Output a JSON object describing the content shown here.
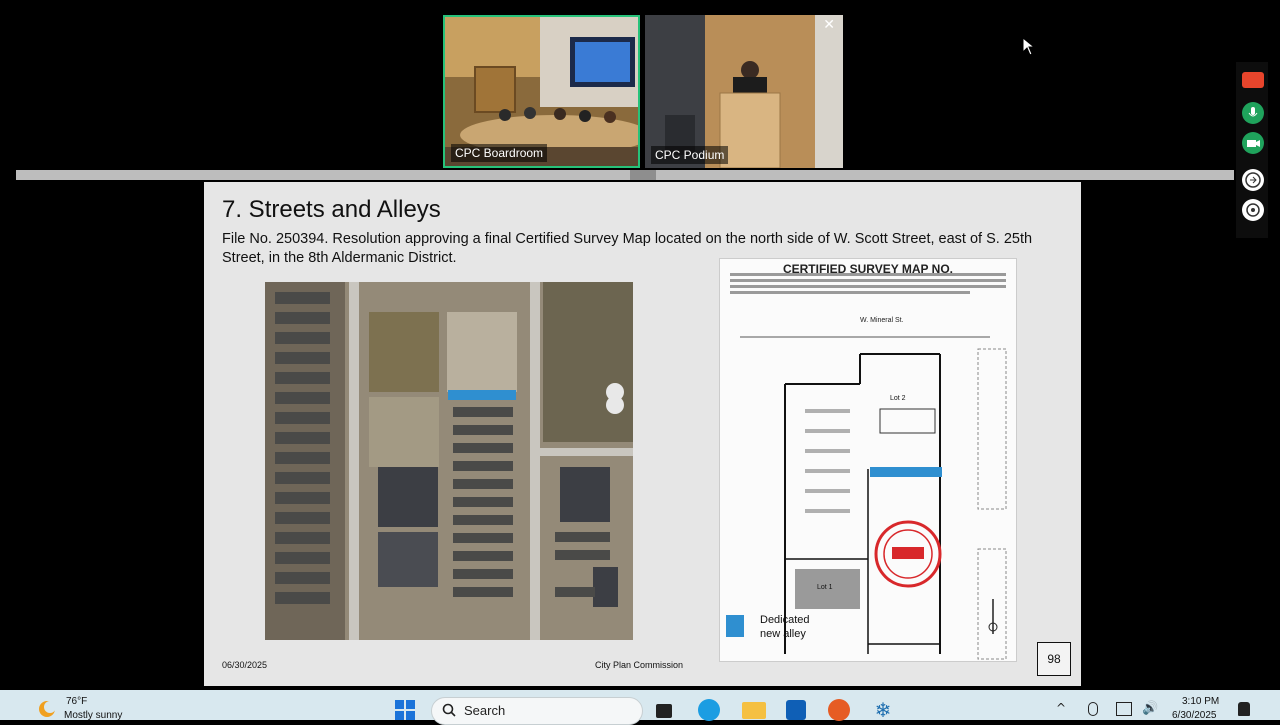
{
  "video": {
    "tiles": [
      {
        "label": "CPC Boardroom"
      },
      {
        "label": "CPC Podium"
      }
    ]
  },
  "slide": {
    "title": "7. Streets and Alleys",
    "description": "File No. 250394. Resolution approving a final Certified Survey Map located on the north side of W. Scott Street, east of S. 25th Street, in the 8th Aldermanic District.",
    "csm_title": "CERTIFIED SURVEY MAP NO.",
    "csm_street_top": "W. Mineral St.",
    "csm_lot2": "Lot 2",
    "csm_lot1": "Lot 1",
    "legend_label": "Dedicated new alley",
    "date": "06/30/2025",
    "footer": "City Plan Commission",
    "page_number": "98"
  },
  "taskbar": {
    "weather_temp": "76°F",
    "weather_desc": "Mostly sunny",
    "search_label": "Search",
    "time": "3:10 PM",
    "date": "6/30/2025"
  },
  "colors": {
    "alley_highlight": "#2f8fd0",
    "active_speaker_border": "#27c27a",
    "seal_red": "#d8282b"
  }
}
